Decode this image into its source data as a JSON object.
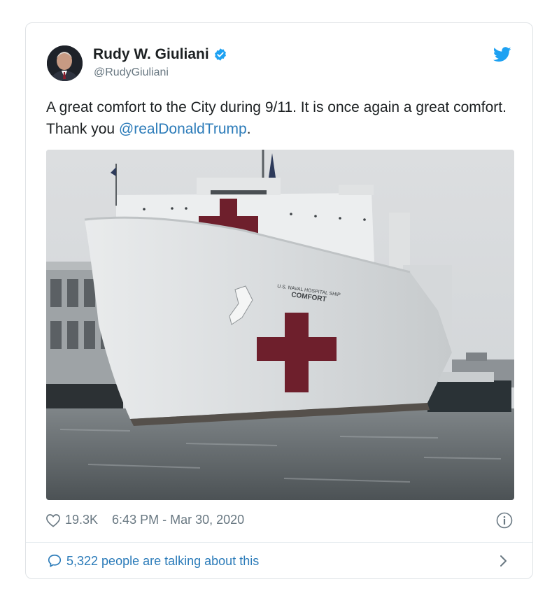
{
  "tweet": {
    "author_name": "Rudy W. Giuliani",
    "handle": "@RudyGiuliani",
    "text_before": "A great comfort to the City during 9/11. It is once again a great comfort. Thank you ",
    "mention": "@realDonaldTrump",
    "text_after": ".",
    "likes": "19.3K",
    "timestamp": "6:43 PM - Mar 30, 2020",
    "talking": "5,322 people are talking about this"
  },
  "photo": {
    "ship_label_line1": "U.S. NAVAL HOSPITAL SHIP",
    "ship_label_line2": "COMFORT"
  },
  "icons": {
    "verified": "verified-badge-icon",
    "brand": "twitter-bird-icon",
    "like": "heart-icon",
    "info": "info-icon",
    "reply": "speech-bubble-icon",
    "more": "chevron-right-icon"
  },
  "colors": {
    "link": "#2b7bb9",
    "twitter_blue": "#1da1f2",
    "meta_gray": "#697882",
    "cross_red": "#6e1f2c"
  }
}
